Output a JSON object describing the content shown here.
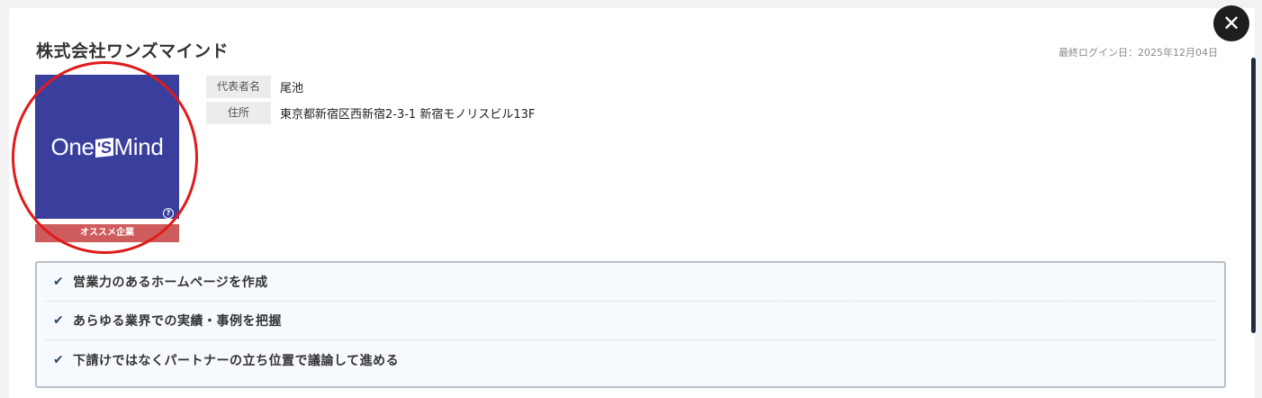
{
  "company": {
    "name": "株式会社ワンズマインド",
    "last_login": "最終ログイン日：2025年12月04日"
  },
  "logo": {
    "text_before": "One",
    "text_s": "'S",
    "text_after": "Mind",
    "help_icon": "question-circle-icon",
    "bg_color": "#3a3f9e"
  },
  "badge": {
    "label": "オススメ企業",
    "color": "#cf5c5c"
  },
  "info": [
    {
      "label": "代表者名",
      "value": "尾池"
    },
    {
      "label": "住所",
      "value": "東京都新宿区西新宿2-3-1 新宿モノリスビル13F"
    }
  ],
  "features": [
    {
      "icon": "check-icon",
      "text": "営業力のあるホームページを作成"
    },
    {
      "icon": "check-icon",
      "text": "あらゆる業界での実績・事例を把握"
    },
    {
      "icon": "check-icon",
      "text": "下請けではなくパートナーの立ち位置で議論して進める"
    }
  ],
  "close_button": {
    "icon": "close-icon",
    "glyph": "✕"
  },
  "help_glyph": "?",
  "check_glyph": "✔"
}
